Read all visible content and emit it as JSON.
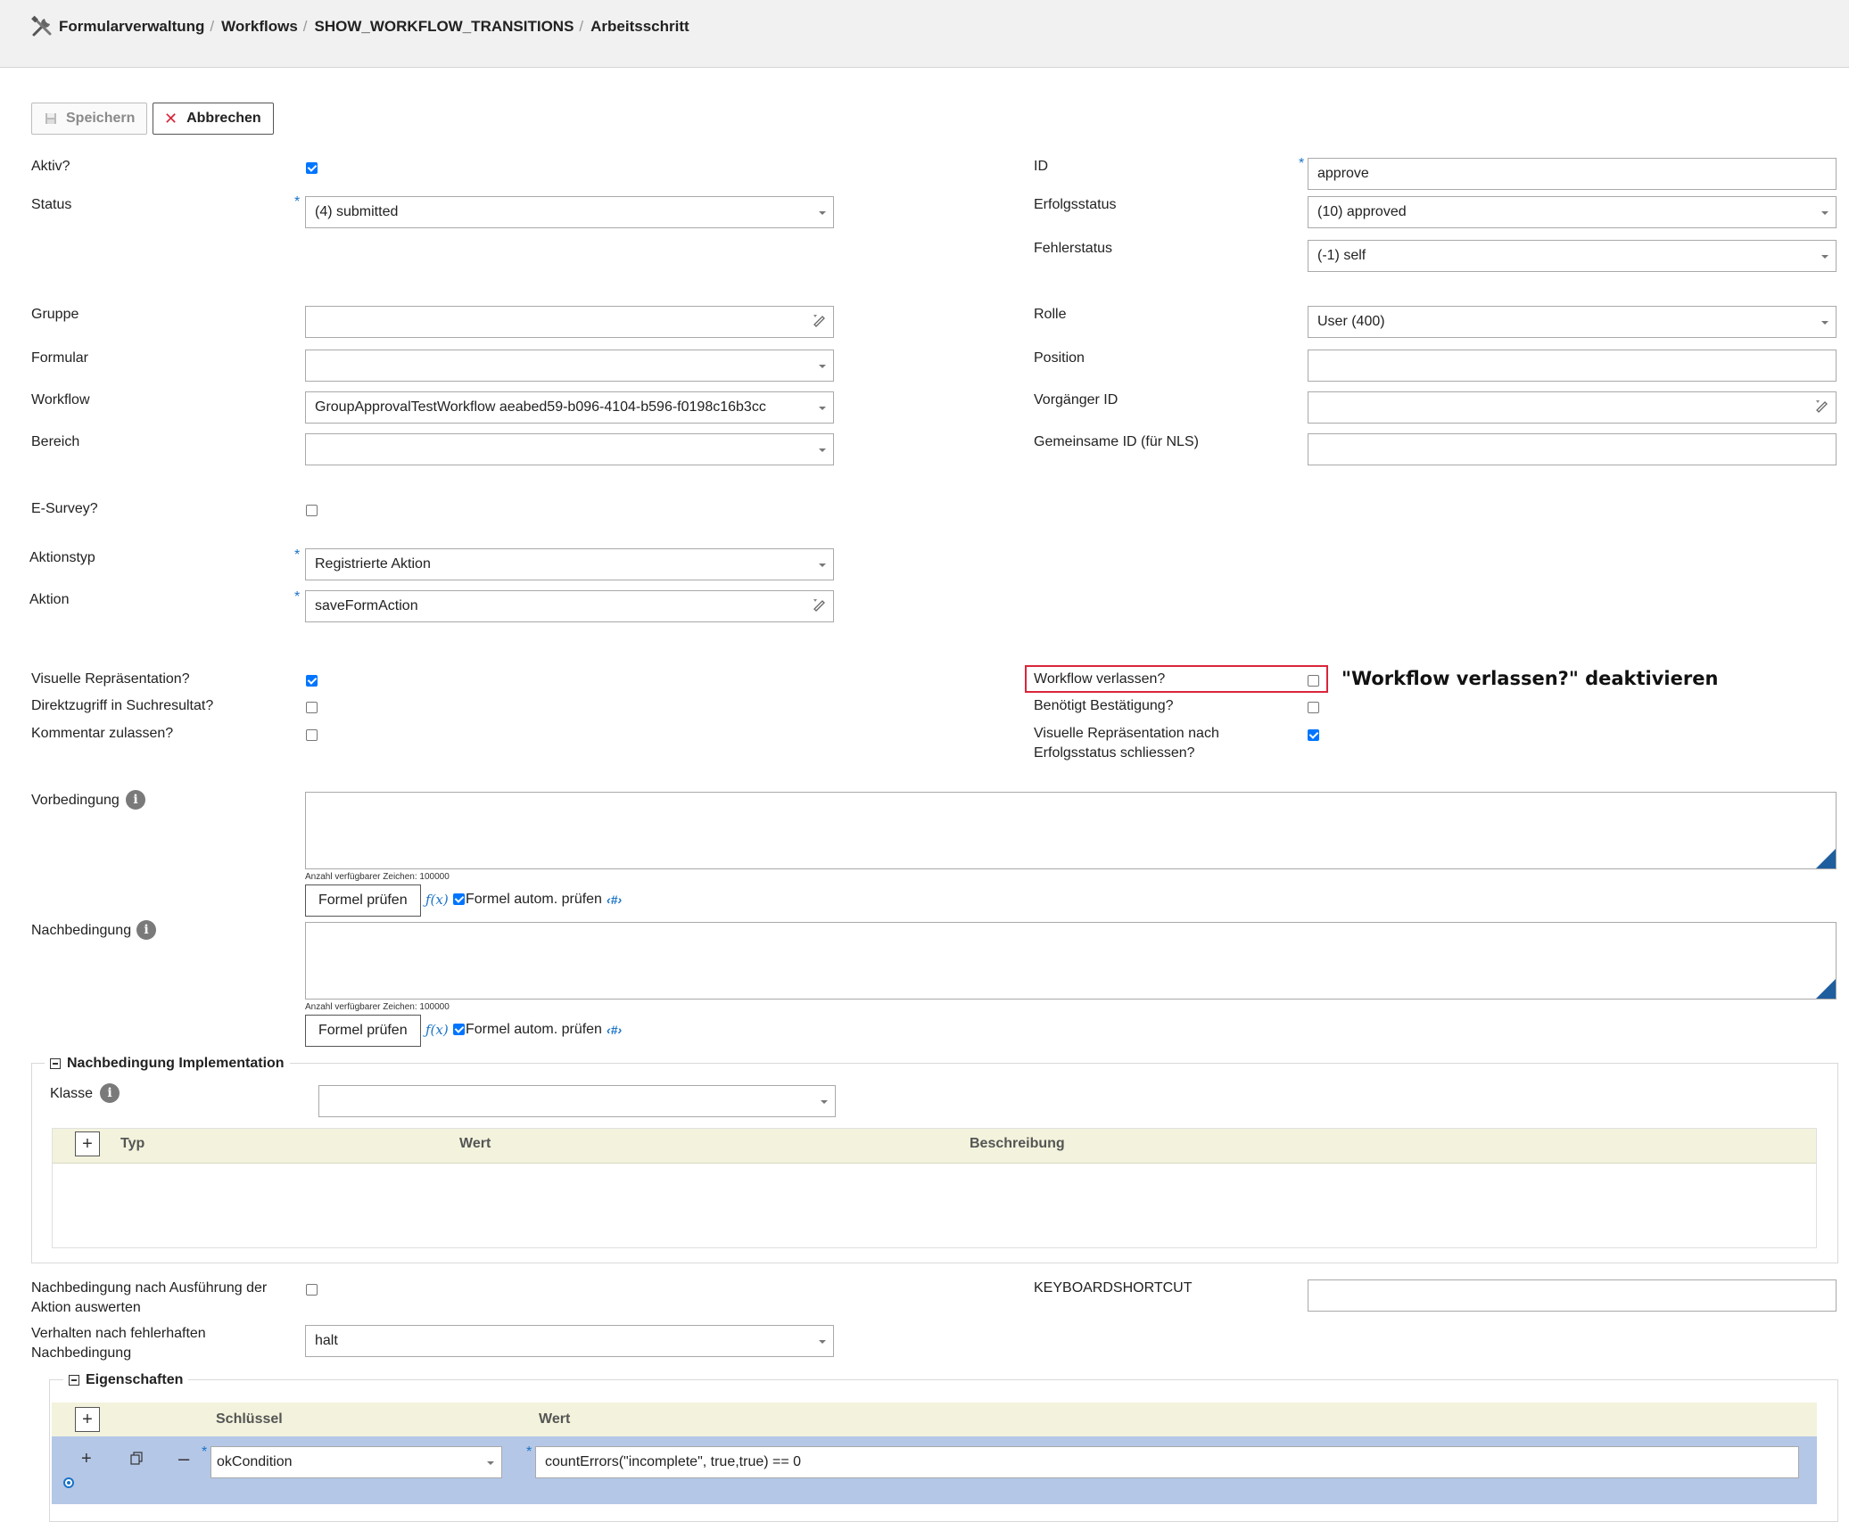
{
  "breadcrumb": [
    "Formularverwaltung",
    "Workflows",
    "SHOW_WORKFLOW_TRANSITIONS",
    "Arbeitsschritt"
  ],
  "toolbar": {
    "save_label": "Speichern",
    "cancel_label": "Abbrechen"
  },
  "left": {
    "aktiv": {
      "label": "Aktiv?",
      "checked": true
    },
    "status": {
      "label": "Status",
      "value": "(4) submitted"
    },
    "gruppe": {
      "label": "Gruppe",
      "value": ""
    },
    "formular": {
      "label": "Formular",
      "value": ""
    },
    "workflow": {
      "label": "Workflow",
      "value": "GroupApprovalTestWorkflow aeabed59-b096-4104-b596-f0198c16b3cc"
    },
    "bereich": {
      "label": "Bereich",
      "value": ""
    },
    "esurvey": {
      "label": "E-Survey?",
      "checked": false
    },
    "aktionstyp": {
      "label": "Aktionstyp",
      "value": "Registrierte Aktion"
    },
    "aktion": {
      "label": "Aktion",
      "value": "saveFormAction"
    },
    "visuelle": {
      "label": "Visuelle Repräsentation?",
      "checked": true
    },
    "direktzugriff": {
      "label": "Direktzugriff in Suchresultat?",
      "checked": false
    },
    "kommentar": {
      "label": "Kommentar zulassen?",
      "checked": false
    }
  },
  "right": {
    "id": {
      "label": "ID",
      "value": "approve"
    },
    "erfolgsstatus": {
      "label": "Erfolgsstatus",
      "value": "(10) approved"
    },
    "fehlerstatus": {
      "label": "Fehlerstatus",
      "value": "(-1) self"
    },
    "rolle": {
      "label": "Rolle",
      "value": "User (400)"
    },
    "position": {
      "label": "Position",
      "value": ""
    },
    "vorgaenger": {
      "label": "Vorgänger ID",
      "value": ""
    },
    "gemeinsame": {
      "label": "Gemeinsame ID (für NLS)",
      "value": ""
    },
    "verlassen": {
      "label": "Workflow verlassen?",
      "checked": false
    },
    "bestaetigung": {
      "label": "Benötigt Bestätigung?",
      "checked": false
    },
    "schliessen": {
      "label_line1": "Visuelle Repräsentation nach",
      "label_line2": "Erfolgsstatus schliessen?",
      "checked": true
    },
    "keyboard": {
      "label": "KEYBOARDSHORTCUT",
      "value": ""
    }
  },
  "annotation": "\"Workflow verlassen?\" deaktivieren",
  "vorbedingung": {
    "label": "Vorbedingung",
    "hint": "Anzahl verfügbarer Zeichen: 100000",
    "check_button": "Formel prüfen",
    "fx": "ƒ(x)",
    "auto_label": "Formel autom. prüfen",
    "auto_checked": true,
    "hash": "‹#›"
  },
  "nachbedingung": {
    "label": "Nachbedingung",
    "hint": "Anzahl verfügbarer Zeichen: 100000",
    "check_button": "Formel prüfen",
    "fx": "ƒ(x)",
    "auto_label": "Formel autom. prüfen",
    "auto_checked": true,
    "hash": "‹#›"
  },
  "impl": {
    "legend": "Nachbedingung Implementation",
    "klasse_label": "Klasse",
    "klasse_value": "",
    "columns": [
      "Typ",
      "Wert",
      "Beschreibung"
    ]
  },
  "nach_ausfuehrung": {
    "label_line1": "Nachbedingung nach Ausführung der",
    "label_line2": "Aktion auswerten",
    "checked": false
  },
  "verhalten": {
    "label_line1": "Verhalten nach fehlerhaften",
    "label_line2": "Nachbedingung",
    "value": "halt"
  },
  "eigenschaften": {
    "legend": "Eigenschaften",
    "columns": [
      "Schlüssel",
      "Wert"
    ],
    "rows": [
      {
        "key": "okCondition",
        "value": "countErrors(\"incomplete\", true,true) == 0"
      }
    ]
  },
  "colors": {
    "accent": "#1a73c7",
    "highlight": "#d9263a",
    "row_selected": "#b4c7e7",
    "table_header": "#f3f3dd"
  }
}
